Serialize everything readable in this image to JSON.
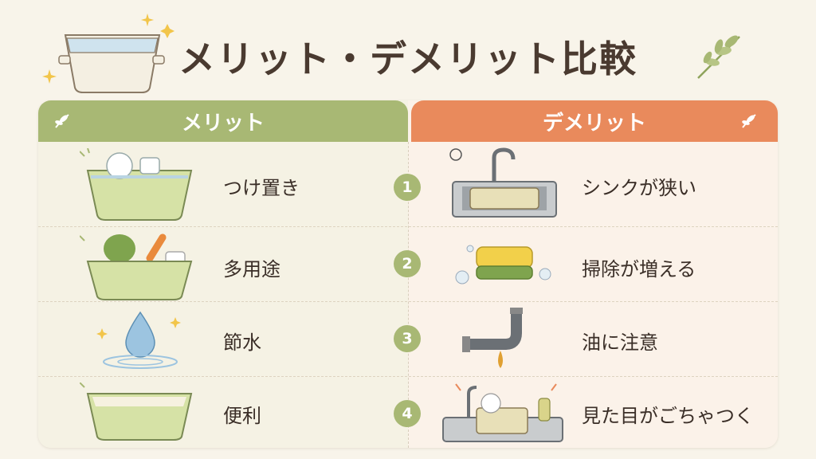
{
  "title": "メリット・デメリット比較",
  "merits": {
    "header": "メリット",
    "items": [
      {
        "label": "つけ置き",
        "icon": "basin-with-dishes-icon"
      },
      {
        "label": "多用途",
        "icon": "basin-with-vegetables-icon"
      },
      {
        "label": "節水",
        "icon": "water-drop-icon"
      },
      {
        "label": "便利",
        "icon": "empty-basin-icon"
      }
    ]
  },
  "demerits": {
    "header": "デメリット",
    "items": [
      {
        "number": "1",
        "label": "シンクが狭い",
        "icon": "sink-with-basin-icon"
      },
      {
        "number": "2",
        "label": "掃除が増える",
        "icon": "sponge-icon"
      },
      {
        "number": "3",
        "label": "油に注意",
        "icon": "drain-pipe-oil-icon"
      },
      {
        "number": "4",
        "label": "見た目がごちゃつく",
        "icon": "cluttered-sink-icon"
      }
    ]
  },
  "colors": {
    "merit_header": "#a8b874",
    "demerit_header": "#e98a5c",
    "number_badge": "#a8b874",
    "background": "#f8f4ea"
  }
}
